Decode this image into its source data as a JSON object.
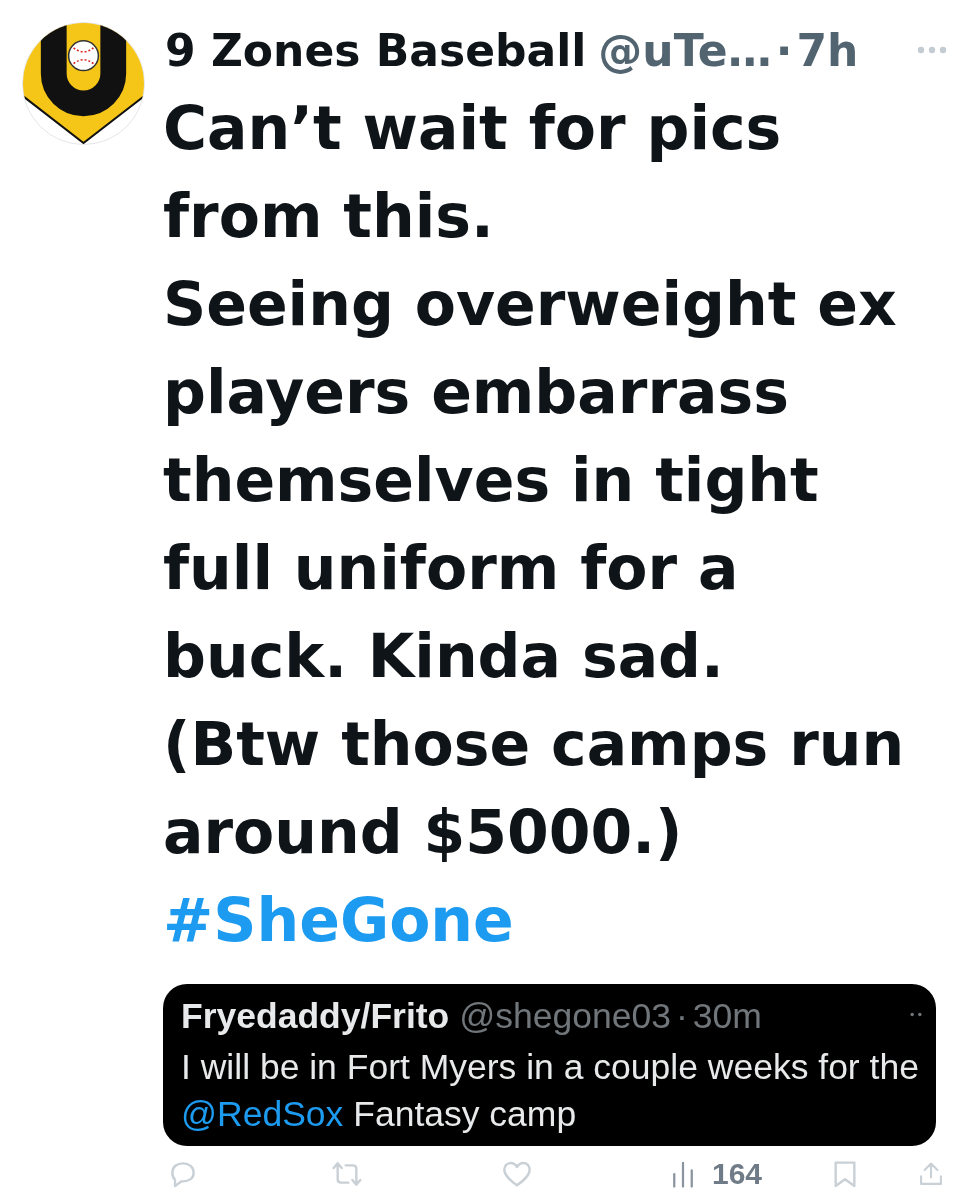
{
  "tweet": {
    "author": {
      "name": "9 Zones Baseball",
      "handle": "@uTe…",
      "separator": "·",
      "time": "7h"
    },
    "text": "Can’t wait for pics from this.\nSeeing overweight ex players embarrass themselves in tight full uniform for a buck. Kinda sad.\n(Btw those camps run around $5000.)",
    "hashtag": "#SheGone",
    "quote": {
      "name": "Fryedaddy/Frito",
      "handle": "@shegone03",
      "separator": "·",
      "time": "30m",
      "segments": [
        {
          "kind": "text",
          "text": "I will be in Fort Myers in a couple weeks for the "
        },
        {
          "kind": "mention",
          "text": "@RedSox"
        },
        {
          "kind": "text",
          "text": " Fantasy camp"
        }
      ]
    },
    "actions": [
      {
        "kind": "reply"
      },
      {
        "kind": "retweet"
      },
      {
        "kind": "like"
      },
      {
        "kind": "views",
        "count": "164"
      },
      {
        "kind": "bookmark"
      },
      {
        "kind": "share"
      }
    ]
  }
}
